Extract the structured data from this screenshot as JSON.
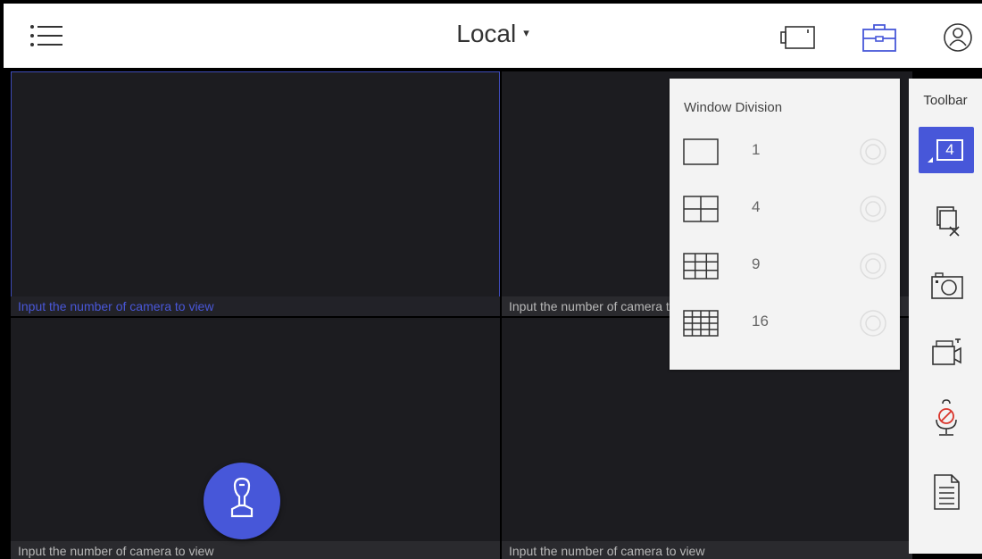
{
  "header": {
    "site_label": "Local",
    "caret": "▾",
    "icons": [
      "menu-icon",
      "monitor-icon",
      "toolbox-icon",
      "user-icon"
    ]
  },
  "grid": {
    "cells": [
      {
        "caption": "Input the number of camera to view",
        "active": true
      },
      {
        "caption": "Input the number of camera to view",
        "active": false
      },
      {
        "caption": "Input the number of camera to view",
        "active": false
      },
      {
        "caption": "Input the number of camera to view",
        "active": false
      }
    ]
  },
  "window_division": {
    "title": "Window Division",
    "options": [
      {
        "label": "1",
        "icon": "grid-1-icon"
      },
      {
        "label": "4",
        "icon": "grid-4-icon"
      },
      {
        "label": "9",
        "icon": "grid-9-icon"
      },
      {
        "label": "16",
        "icon": "grid-16-icon"
      }
    ]
  },
  "toolbar": {
    "title": "Toolbar",
    "division_value": "4",
    "tools": [
      "window-division-icon",
      "close-all-icon",
      "capture-icon",
      "record-icon",
      "audio-mute-icon",
      "log-icon"
    ]
  },
  "colors": {
    "accent": "#4757d9",
    "video_bg": "#1c1c20",
    "panel_bg": "#f3f3f3"
  }
}
